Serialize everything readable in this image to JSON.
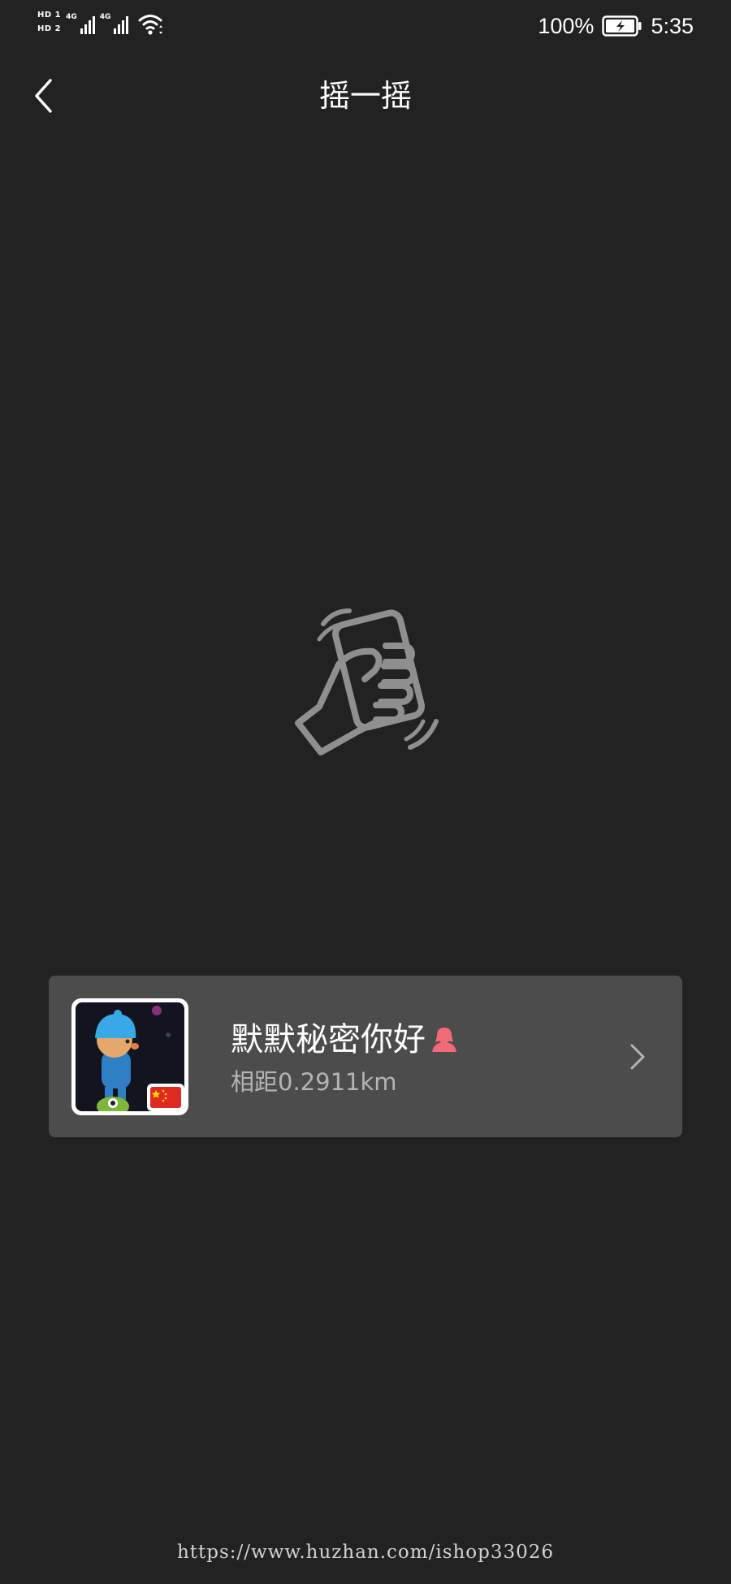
{
  "status_bar": {
    "hd1": "HD 1",
    "hd2": "HD 2",
    "network1": "4G",
    "network2": "4G",
    "battery": "100%",
    "time": "5:35",
    "icons": [
      "signal-icon",
      "signal-icon",
      "wifi-icon",
      "battery-charging-icon"
    ]
  },
  "nav": {
    "title": "摇一摇",
    "back_icon": "chevron-left-icon"
  },
  "illustration": {
    "icon": "hand-shaking-phone-icon",
    "color": "#8f8f8f"
  },
  "result": {
    "name": "默默秘密你好",
    "gender_icon": "female-icon",
    "gender_color": "#f06a78",
    "distance": "相距0.2911km",
    "avatar_icon": "cartoon-avatar",
    "chevron_icon": "chevron-right-icon"
  },
  "watermark": "https://www.huzhan.com/ishop33026",
  "colors": {
    "background": "#222222",
    "card": "#4c4c4c",
    "text_primary": "#ffffff",
    "text_secondary": "#b4b4b4"
  }
}
